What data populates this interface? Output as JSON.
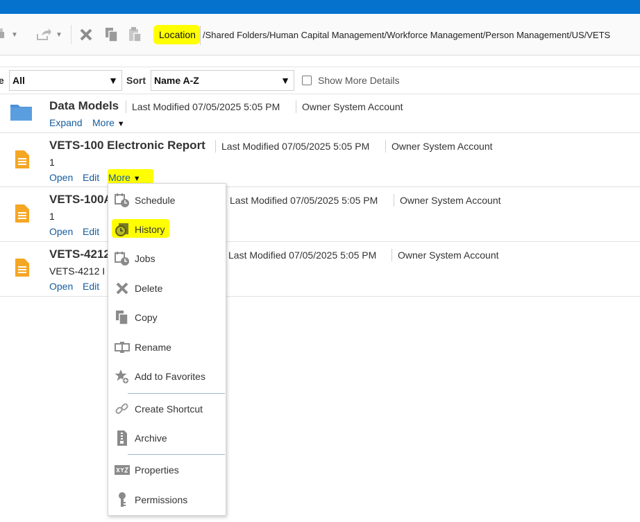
{
  "toolbar": {
    "location_label": "Location",
    "location_path": "/Shared Folders/Human Capital Management/Workforce Management/Person Management/US/VETS"
  },
  "filters": {
    "type_label_partial": "e",
    "type_value": "All",
    "sort_label": "Sort",
    "sort_value": "Name A-Z",
    "show_details_label": "Show More Details"
  },
  "items": [
    {
      "title": "Data Models",
      "last_modified": "Last Modified 07/05/2025 5:05 PM",
      "owner": "Owner System Account",
      "links": [
        "Expand",
        "More"
      ]
    },
    {
      "title": "VETS-100 Electronic Report",
      "last_modified": "Last Modified 07/05/2025 5:05 PM",
      "owner": "Owner System Account",
      "description": "1",
      "links": [
        "Open",
        "Edit",
        "More"
      ]
    },
    {
      "title": "VETS-100A",
      "last_modified": "Last Modified 07/05/2025 5:05 PM",
      "owner": "Owner System Account",
      "description": "1",
      "links": [
        "Open",
        "Edit"
      ]
    },
    {
      "title": "VETS-4212",
      "last_modified": "Last Modified 07/05/2025 5:05 PM",
      "owner": "Owner System Account",
      "description": "VETS-4212 I",
      "links": [
        "Open",
        "Edit"
      ]
    }
  ],
  "menu": {
    "items": [
      {
        "label": "Schedule",
        "icon": "schedule-icon"
      },
      {
        "label": "History",
        "icon": "history-icon"
      },
      {
        "label": "Jobs",
        "icon": "jobs-icon"
      },
      {
        "label": "Delete",
        "icon": "delete-icon"
      },
      {
        "label": "Copy",
        "icon": "copy-icon"
      },
      {
        "label": "Rename",
        "icon": "rename-icon"
      },
      {
        "label": "Add to Favorites",
        "icon": "favorites-icon"
      },
      {
        "label": "Create Shortcut",
        "icon": "shortcut-icon"
      },
      {
        "label": "Archive",
        "icon": "archive-icon"
      },
      {
        "label": "Properties",
        "icon": "properties-icon"
      },
      {
        "label": "Permissions",
        "icon": "permissions-icon"
      }
    ]
  },
  "colors": {
    "topbar": "#0572ce",
    "link": "#145c9e",
    "highlight": "#ffff00",
    "file_icon": "#f5a623",
    "folder_icon": "#4a90d9"
  }
}
